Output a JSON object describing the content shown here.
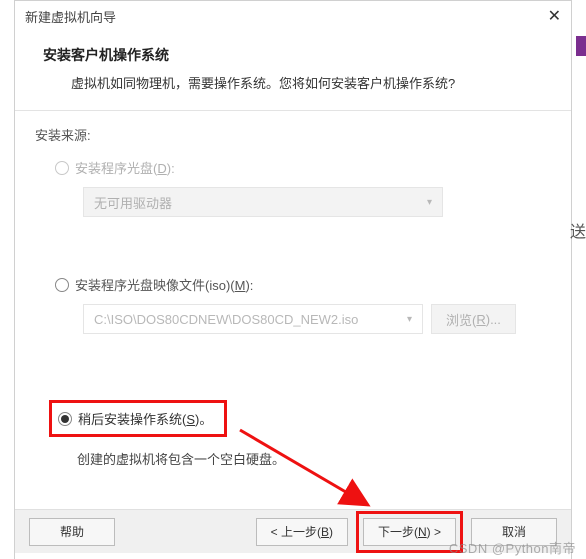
{
  "window": {
    "title": "新建虚拟机向导"
  },
  "header": {
    "title": "安装客户机操作系统",
    "subtitle": "虚拟机如同物理机，需要操作系统。您将如何安装客户机操作系统?"
  },
  "source": {
    "label": "安装来源:",
    "disc": {
      "label_prefix": "安装程序光盘(",
      "accel": "D",
      "label_suffix": "):",
      "select_value": "无可用驱动器"
    },
    "iso": {
      "label_prefix": "安装程序光盘映像文件(iso)(",
      "accel": "M",
      "label_suffix": "):",
      "path": "C:\\ISO\\DOS80CDNEW\\DOS80CD_NEW2.iso",
      "browse_prefix": "浏览(",
      "browse_accel": "R",
      "browse_suffix": ")..."
    },
    "later": {
      "label_prefix": "稍后安装操作系统(",
      "accel": "S",
      "label_suffix": ")。",
      "hint": "创建的虚拟机将包含一个空白硬盘。"
    }
  },
  "buttons": {
    "help": "帮助",
    "back_prefix": "< 上一步(",
    "back_accel": "B",
    "back_suffix": ")",
    "next_prefix": "下一步(",
    "next_accel": "N",
    "next_suffix": ") >",
    "cancel": "取消"
  },
  "watermark": "CSDN @Python南帝",
  "edge_text": "送"
}
